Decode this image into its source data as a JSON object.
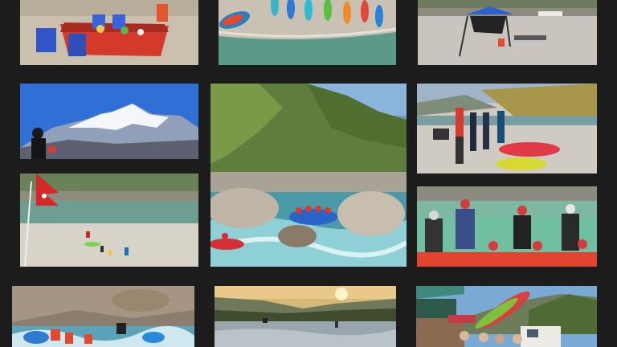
{
  "gallery": {
    "photos": [
      {
        "id": "riverside-dining-table",
        "icon": "photo"
      },
      {
        "id": "kayaks-on-beach-aerial",
        "icon": "photo"
      },
      {
        "id": "beach-camp-canopy",
        "icon": "photo"
      },
      {
        "id": "snow-mountain-peak",
        "icon": "photo"
      },
      {
        "id": "rafting-boulder-rapids",
        "icon": "photo"
      },
      {
        "id": "kayakers-on-riverbank",
        "icon": "photo"
      },
      {
        "id": "river-beach-flag",
        "icon": "photo"
      },
      {
        "id": "rafting-group-cheering",
        "icon": "photo"
      },
      {
        "id": "kayakers-whitewater",
        "icon": "photo"
      },
      {
        "id": "river-valley-sunset",
        "icon": "photo"
      },
      {
        "id": "kayak-trailer-van",
        "icon": "photo"
      }
    ],
    "colors": {
      "background": "#1c1c1c",
      "river": "#5f9e98",
      "sand": "#cfc6b8",
      "sky": "#2f6fd6",
      "raft_red": "#d63a34"
    }
  }
}
